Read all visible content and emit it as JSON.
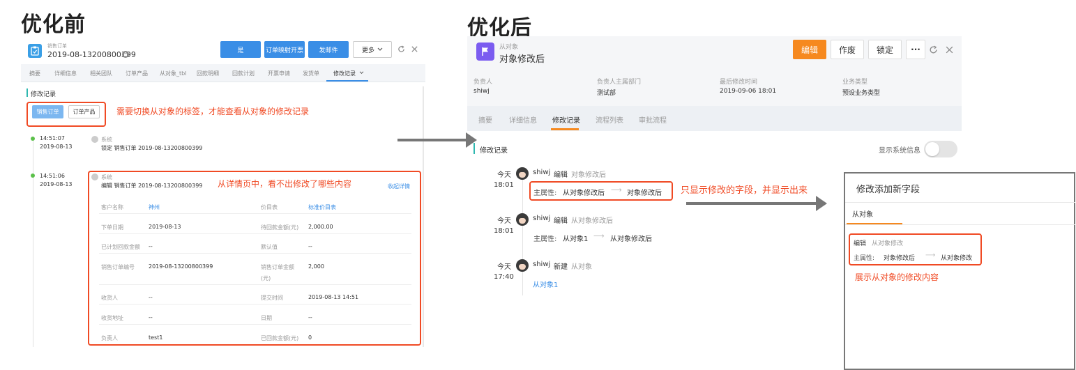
{
  "before": {
    "heading": "优化前",
    "header": {
      "subtitle": "销售订单",
      "title": "2019-08-13200800399",
      "buttons": [
        "是",
        "订单映射开票",
        "发邮件"
      ],
      "more": "更多"
    },
    "tabs": [
      "摘要",
      "详细信息",
      "相关团队",
      "订单产品",
      "从对象_tbl",
      "回款明细",
      "回款计划",
      "开票申请",
      "发货单",
      "修改记录"
    ],
    "section_title": "修改记录",
    "chips": [
      "销售订单",
      "订单产品"
    ],
    "note1": "需要切换从对象的标签，才能查看从对象的修改记录",
    "timeline": [
      {
        "time": "14:51:07",
        "date": "2019-08-13",
        "user": "系统",
        "text": "锁定 销售订单 2019-08-13200800399"
      },
      {
        "time": "14:51:06",
        "date": "2019-08-13",
        "user": "系统",
        "text": "编辑 销售订单 2019-08-13200800399"
      }
    ],
    "note2": "从详情页中，看不出修改了哪些内容",
    "collapse": "收起详情",
    "fields": [
      {
        "l1": "客户名称",
        "v1": "神州",
        "l2": "价目表",
        "v2": "标准价目表"
      },
      {
        "l1": "下单日期",
        "v1": "2019-08-13",
        "l2": "待回款金额(元)",
        "v2": "2,000.00"
      },
      {
        "l1": "已计划回款金额",
        "v1": "--",
        "l2": "默认值",
        "v2": "--"
      },
      {
        "l1": "销售订单编号",
        "v1": "2019-08-13200800399",
        "l2": "销售订单金额",
        "l2b": "(元)",
        "v2": "2,000"
      },
      {
        "l1": "收货人",
        "v1": "--",
        "l2": "提交时间",
        "v2": "2019-08-13 14:51"
      },
      {
        "l1": "收货地址",
        "v1": "--",
        "l2": "日期",
        "v2": "--"
      },
      {
        "l1": "负责人",
        "v1": "test1",
        "l2": "已回款金额(元)",
        "v2": "0"
      }
    ]
  },
  "after": {
    "heading": "优化后",
    "header": {
      "subtitle": "从对象",
      "title": "对象修改后",
      "edit": "编辑",
      "void": "作废",
      "lock": "锁定",
      "more": "···"
    },
    "info": [
      {
        "label": "负责人",
        "value": "shiwj"
      },
      {
        "label": "负责人主属部门",
        "value": "测试部"
      },
      {
        "label": "最后修改时间",
        "value": "2019-09-06 18:01"
      },
      {
        "label": "业务类型",
        "value": "预设业务类型"
      }
    ],
    "tabs": [
      "摘要",
      "详细信息",
      "修改记录",
      "流程列表",
      "审批流程"
    ],
    "section_title": "修改记录",
    "toggle_label": "显示系统信息",
    "records": [
      {
        "day": "今天",
        "time": "18:01",
        "user": "shiwj",
        "action": "编辑",
        "target": "对象修改后",
        "field": "主属性:",
        "from": "从对象修改后",
        "to": "对象修改后"
      },
      {
        "day": "今天",
        "time": "18:01",
        "user": "shiwj",
        "action": "编辑",
        "target": "从对象修改后",
        "field": "主属性:",
        "from": "从对象1",
        "to": "从对象修改后"
      },
      {
        "day": "今天",
        "time": "17:40",
        "user": "shiwj",
        "action": "新建",
        "target": "从对象",
        "link": "从对象1"
      }
    ],
    "note": "只显示修改的字段，并显示出来"
  },
  "panel": {
    "title": "修改添加新字段",
    "tab": "从对象",
    "action": "编辑",
    "target": "从对象修改",
    "field": "主属性:",
    "from": "对象修改后",
    "to": "从对象修改",
    "note": "展示从对象的修改内容"
  },
  "colors": {
    "accent": "#f04a24",
    "primary": "#3a8ee6",
    "orange": "#f6891f",
    "green": "#5bc04a"
  },
  "icons": [
    "clipboard-icon",
    "lock-icon",
    "flag-icon",
    "refresh-icon",
    "close-icon",
    "chevron-down-icon"
  ]
}
